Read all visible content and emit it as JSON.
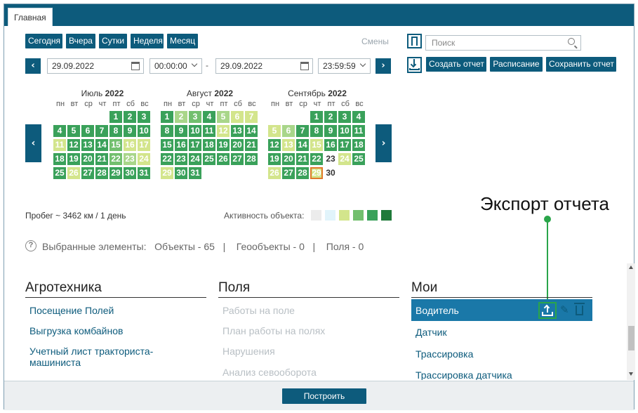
{
  "tab": {
    "label": "Главная"
  },
  "period_buttons": [
    "Сегодня",
    "Вчера",
    "Сутки",
    "Неделя",
    "Месяц"
  ],
  "shifts_label": "Смены",
  "search": {
    "placeholder": "Поиск"
  },
  "date_from": "29.09.2022",
  "time_from": "00:00:00",
  "date_to": "29.09.2022",
  "time_to": "23:59:59",
  "range_separator": "-",
  "actions": {
    "create_report": "Создать отчет",
    "schedule": "Расписание",
    "save_report": "Сохранить отчет"
  },
  "calendar": {
    "weekdays": [
      "пн",
      "вт",
      "ср",
      "чт",
      "пт",
      "сб",
      "вс"
    ],
    "months": [
      {
        "name": "Июль",
        "year": "2022",
        "offset": 4,
        "days": [
          [
            1,
            4
          ],
          [
            2,
            4
          ],
          [
            3,
            4
          ],
          [
            4,
            4
          ],
          [
            5,
            4
          ],
          [
            6,
            4
          ],
          [
            7,
            4
          ],
          [
            8,
            4
          ],
          [
            9,
            4
          ],
          [
            10,
            4
          ],
          [
            11,
            1
          ],
          [
            12,
            4
          ],
          [
            13,
            4
          ],
          [
            14,
            4
          ],
          [
            15,
            3
          ],
          [
            16,
            1
          ],
          [
            17,
            1
          ],
          [
            18,
            4
          ],
          [
            19,
            4
          ],
          [
            20,
            4
          ],
          [
            21,
            4
          ],
          [
            22,
            3
          ],
          [
            23,
            2
          ],
          [
            24,
            1
          ],
          [
            25,
            4
          ],
          [
            26,
            1
          ],
          [
            27,
            4
          ],
          [
            28,
            4
          ],
          [
            29,
            4
          ],
          [
            30,
            4
          ],
          [
            31,
            4
          ]
        ]
      },
      {
        "name": "Август",
        "year": "2022",
        "offset": 0,
        "days": [
          [
            1,
            4
          ],
          [
            2,
            2
          ],
          [
            3,
            3
          ],
          [
            4,
            4
          ],
          [
            5,
            2
          ],
          [
            6,
            1
          ],
          [
            7,
            1
          ],
          [
            8,
            4
          ],
          [
            9,
            4
          ],
          [
            10,
            4
          ],
          [
            11,
            4
          ],
          [
            12,
            1
          ],
          [
            13,
            4
          ],
          [
            14,
            4
          ],
          [
            15,
            4
          ],
          [
            16,
            4
          ],
          [
            17,
            4
          ],
          [
            18,
            4
          ],
          [
            19,
            4
          ],
          [
            20,
            4
          ],
          [
            21,
            4
          ],
          [
            22,
            4
          ],
          [
            23,
            4
          ],
          [
            24,
            4
          ],
          [
            25,
            4
          ],
          [
            26,
            4
          ],
          [
            27,
            4
          ],
          [
            28,
            4
          ],
          [
            29,
            1
          ],
          [
            30,
            4
          ],
          [
            31,
            4
          ]
        ]
      },
      {
        "name": "Сентябрь",
        "year": "2022",
        "offset": 3,
        "days": [
          [
            1,
            4
          ],
          [
            2,
            4
          ],
          [
            3,
            4
          ],
          [
            4,
            4
          ],
          [
            5,
            1
          ],
          [
            6,
            2
          ],
          [
            7,
            4
          ],
          [
            8,
            4
          ],
          [
            9,
            4
          ],
          [
            10,
            4
          ],
          [
            11,
            4
          ],
          [
            12,
            4
          ],
          [
            13,
            1
          ],
          [
            14,
            4
          ],
          [
            15,
            1
          ],
          [
            16,
            4
          ],
          [
            17,
            4
          ],
          [
            18,
            4
          ],
          [
            19,
            4
          ],
          [
            20,
            4
          ],
          [
            21,
            4
          ],
          [
            22,
            4
          ],
          [
            23,
            0
          ],
          [
            24,
            1
          ],
          [
            25,
            4
          ],
          [
            26,
            1
          ],
          [
            27,
            4
          ],
          [
            28,
            4
          ],
          [
            29,
            5
          ],
          [
            30,
            0
          ]
        ]
      }
    ]
  },
  "mileage": "Пробег ~ 3462 км / 1 день",
  "activity_label": "Активность объекта:",
  "activity_colors": [
    "#ececec",
    "#e1f4fb",
    "#d3e58c",
    "#72bf6e",
    "#3aa15a",
    "#1f7a3a"
  ],
  "annotation": "Экспорт отчета",
  "selected": {
    "label": "Выбранные элементы:",
    "objects": "Объекты - 65",
    "geoobjects": "Геообъекты - 0",
    "fields": "Поля - 0",
    "sep": "|"
  },
  "columns": {
    "agro": {
      "title": "Агротехника",
      "items": [
        "Посещение Полей",
        "Выгрузка комбайнов",
        "Учетный лист тракториста-машиниста"
      ]
    },
    "fields": {
      "title": "Поля",
      "items": [
        "Работы на поле",
        "План работы на полях",
        "Нарушения",
        "Анализ севооборота"
      ]
    },
    "mine": {
      "title": "Мои",
      "selected": "Водитель",
      "items": [
        "Датчик",
        "Трассировка",
        "Трассировка датчика"
      ]
    }
  },
  "build_button": "Построить"
}
